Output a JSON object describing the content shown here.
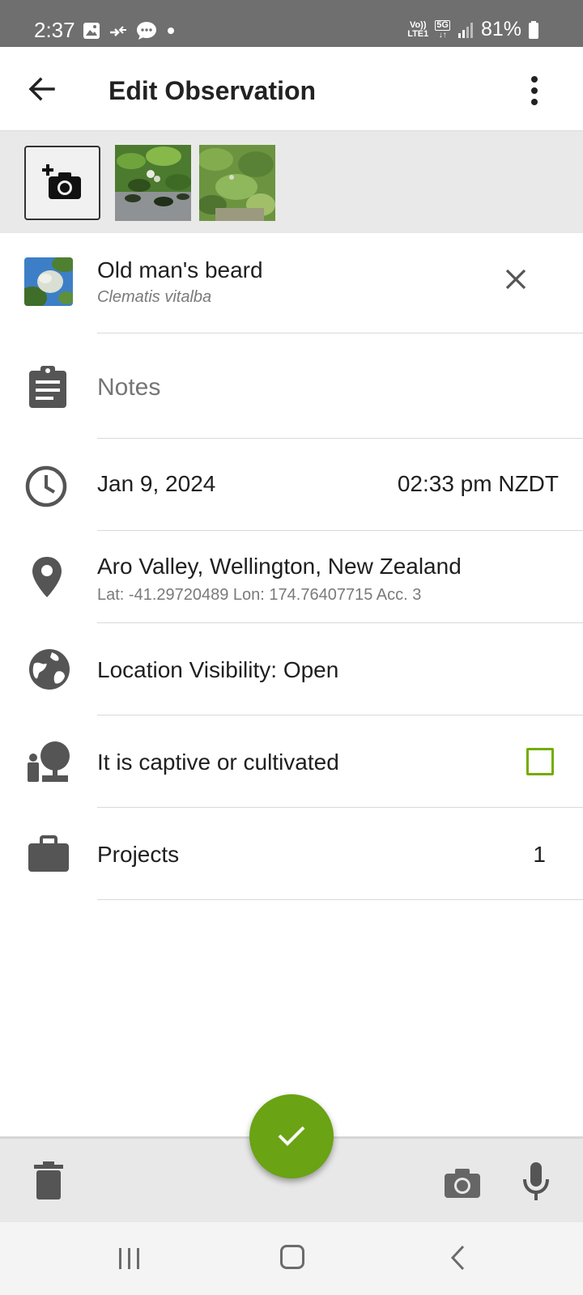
{
  "status_bar": {
    "time": "2:37",
    "network_top": "Vo))",
    "network_bottom": "LTE1",
    "network_type": "5G",
    "battery": "81%",
    "icons": [
      "image-icon",
      "call-forward-icon",
      "message-icon",
      "dot-icon",
      "signal-icon",
      "battery-icon"
    ]
  },
  "app_bar": {
    "title": "Edit Observation",
    "back_icon": "back-arrow-icon",
    "menu_icon": "more-vert-icon"
  },
  "photos": {
    "add_icon": "add-photo-icon",
    "count": 2
  },
  "taxon": {
    "common_name": "Old man's beard",
    "scientific_name": "Clematis vitalba",
    "clear_icon": "close-icon"
  },
  "notes": {
    "placeholder": "Notes",
    "icon": "clipboard-icon"
  },
  "datetime": {
    "date": "Jan 9, 2024",
    "time": "02:33 pm NZDT",
    "icon": "clock-icon"
  },
  "location": {
    "place": "Aro Valley, Wellington, New Zealand",
    "coords": "Lat: -41.29720489 Lon: 174.76407715 Acc. 3",
    "icon": "location-pin-icon"
  },
  "visibility": {
    "label": "Location Visibility: Open",
    "icon": "globe-icon"
  },
  "captive": {
    "label": "It is captive or cultivated",
    "checked": false,
    "icon": "potted-plant-icon"
  },
  "projects": {
    "label": "Projects",
    "count": "1",
    "icon": "briefcase-icon"
  },
  "colors": {
    "accent": "#74ac00",
    "fab": "#6aa313",
    "statusbar": "#6f6f6f"
  }
}
